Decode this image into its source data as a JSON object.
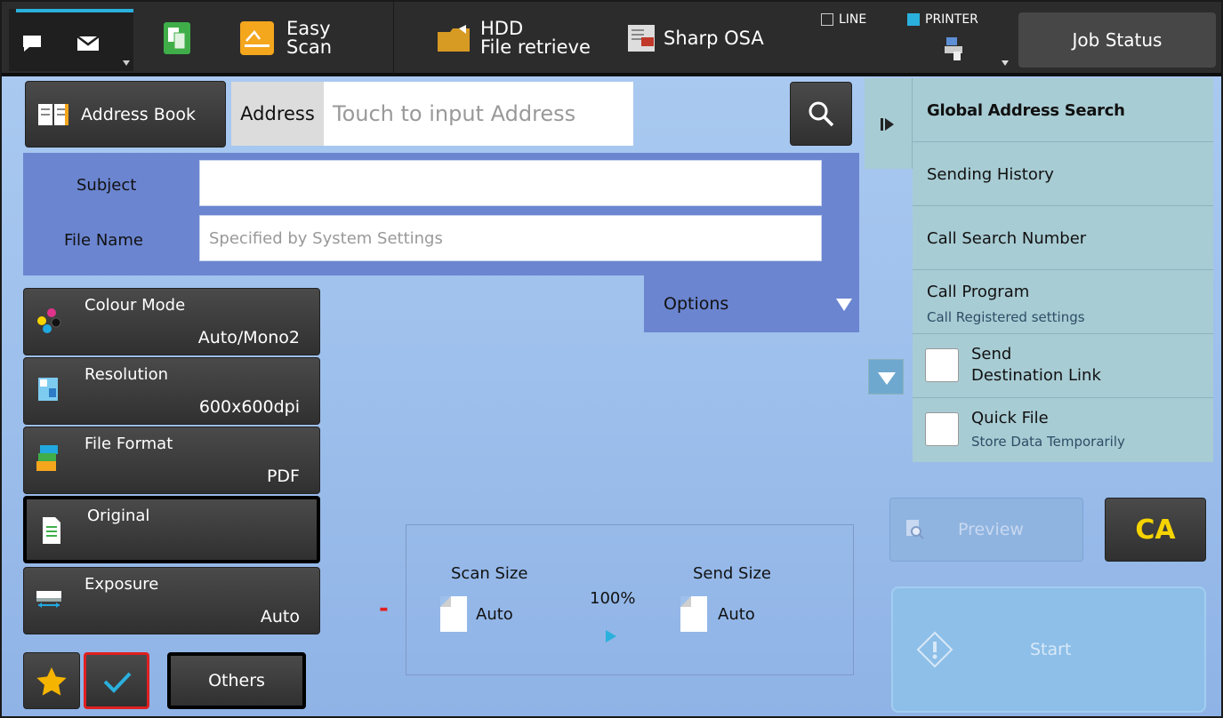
{
  "topbar": {
    "easy_scan": "Easy\nScan",
    "hdd": "HDD",
    "file_retrieve": "File retrieve",
    "sharp_osa": "Sharp OSA",
    "line": "LINE",
    "printer": "PRINTER",
    "job_status": "Job Status"
  },
  "address": {
    "book_label": "Address Book",
    "label": "Address",
    "placeholder": "Touch to input Address"
  },
  "form": {
    "subject_label": "Subject",
    "subject_value": "",
    "filename_label": "File Name",
    "filename_placeholder": "Specified by System Settings",
    "options_label": "Options"
  },
  "functions": [
    {
      "title": "Colour Mode",
      "value": "Auto/Mono2",
      "icon": "colour-mode-icon"
    },
    {
      "title": "Resolution",
      "value": "600x600dpi",
      "icon": "resolution-icon"
    },
    {
      "title": "File Format",
      "value": "PDF",
      "icon": "file-format-icon"
    },
    {
      "title": "Original",
      "value": "",
      "icon": "original-icon"
    },
    {
      "title": "Exposure",
      "value": "Auto",
      "icon": "exposure-icon"
    }
  ],
  "bottom": {
    "others": "Others",
    "minus": "-"
  },
  "size": {
    "scan_size_label": "Scan Size",
    "scan_size_value": "Auto",
    "ratio": "100%",
    "send_size_label": "Send Size",
    "send_size_value": "Auto"
  },
  "right_panel": {
    "global_search": "Global Address Search",
    "sending_history": "Sending History",
    "call_search_number": "Call Search Number",
    "call_program": "Call Program",
    "call_program_sub": "Call Registered settings",
    "send_dest_link_1": "Send",
    "send_dest_link_2": "Destination Link",
    "quick_file": "Quick File",
    "quick_file_sub": "Store Data Temporarily"
  },
  "actions": {
    "preview": "Preview",
    "ca": "CA",
    "start": "Start"
  },
  "colors": {
    "accent": "#2ab0dd",
    "form_panel": "#6b85d0",
    "right_panel": "#a8ccd4",
    "ca_text": "#f5d400"
  }
}
